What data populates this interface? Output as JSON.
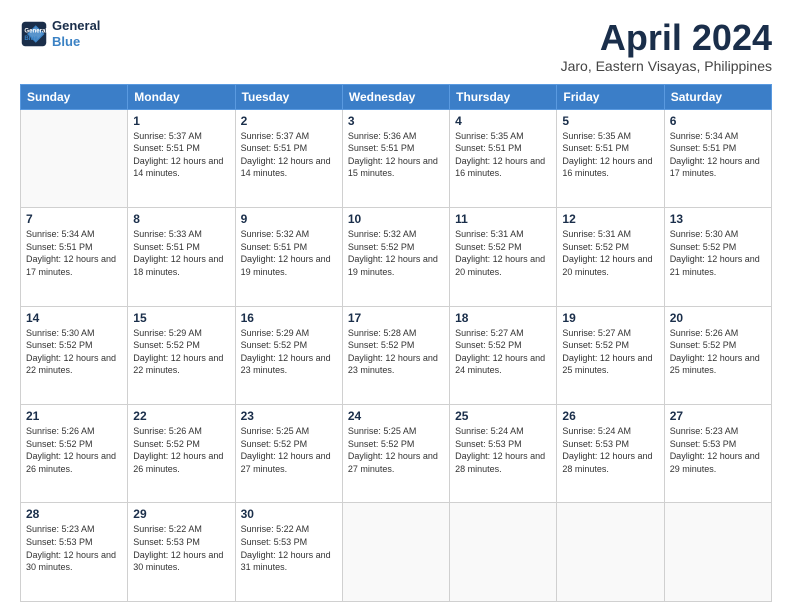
{
  "header": {
    "logo_line1": "General",
    "logo_line2": "Blue",
    "month_title": "April 2024",
    "location": "Jaro, Eastern Visayas, Philippines"
  },
  "columns": [
    "Sunday",
    "Monday",
    "Tuesday",
    "Wednesday",
    "Thursday",
    "Friday",
    "Saturday"
  ],
  "weeks": [
    [
      {
        "day": "",
        "sunrise": "",
        "sunset": "",
        "daylight": ""
      },
      {
        "day": "1",
        "sunrise": "5:37 AM",
        "sunset": "5:51 PM",
        "daylight": "12 hours and 14 minutes."
      },
      {
        "day": "2",
        "sunrise": "5:37 AM",
        "sunset": "5:51 PM",
        "daylight": "12 hours and 14 minutes."
      },
      {
        "day": "3",
        "sunrise": "5:36 AM",
        "sunset": "5:51 PM",
        "daylight": "12 hours and 15 minutes."
      },
      {
        "day": "4",
        "sunrise": "5:35 AM",
        "sunset": "5:51 PM",
        "daylight": "12 hours and 16 minutes."
      },
      {
        "day": "5",
        "sunrise": "5:35 AM",
        "sunset": "5:51 PM",
        "daylight": "12 hours and 16 minutes."
      },
      {
        "day": "6",
        "sunrise": "5:34 AM",
        "sunset": "5:51 PM",
        "daylight": "12 hours and 17 minutes."
      }
    ],
    [
      {
        "day": "7",
        "sunrise": "5:34 AM",
        "sunset": "5:51 PM",
        "daylight": "12 hours and 17 minutes."
      },
      {
        "day": "8",
        "sunrise": "5:33 AM",
        "sunset": "5:51 PM",
        "daylight": "12 hours and 18 minutes."
      },
      {
        "day": "9",
        "sunrise": "5:32 AM",
        "sunset": "5:51 PM",
        "daylight": "12 hours and 19 minutes."
      },
      {
        "day": "10",
        "sunrise": "5:32 AM",
        "sunset": "5:52 PM",
        "daylight": "12 hours and 19 minutes."
      },
      {
        "day": "11",
        "sunrise": "5:31 AM",
        "sunset": "5:52 PM",
        "daylight": "12 hours and 20 minutes."
      },
      {
        "day": "12",
        "sunrise": "5:31 AM",
        "sunset": "5:52 PM",
        "daylight": "12 hours and 20 minutes."
      },
      {
        "day": "13",
        "sunrise": "5:30 AM",
        "sunset": "5:52 PM",
        "daylight": "12 hours and 21 minutes."
      }
    ],
    [
      {
        "day": "14",
        "sunrise": "5:30 AM",
        "sunset": "5:52 PM",
        "daylight": "12 hours and 22 minutes."
      },
      {
        "day": "15",
        "sunrise": "5:29 AM",
        "sunset": "5:52 PM",
        "daylight": "12 hours and 22 minutes."
      },
      {
        "day": "16",
        "sunrise": "5:29 AM",
        "sunset": "5:52 PM",
        "daylight": "12 hours and 23 minutes."
      },
      {
        "day": "17",
        "sunrise": "5:28 AM",
        "sunset": "5:52 PM",
        "daylight": "12 hours and 23 minutes."
      },
      {
        "day": "18",
        "sunrise": "5:27 AM",
        "sunset": "5:52 PM",
        "daylight": "12 hours and 24 minutes."
      },
      {
        "day": "19",
        "sunrise": "5:27 AM",
        "sunset": "5:52 PM",
        "daylight": "12 hours and 25 minutes."
      },
      {
        "day": "20",
        "sunrise": "5:26 AM",
        "sunset": "5:52 PM",
        "daylight": "12 hours and 25 minutes."
      }
    ],
    [
      {
        "day": "21",
        "sunrise": "5:26 AM",
        "sunset": "5:52 PM",
        "daylight": "12 hours and 26 minutes."
      },
      {
        "day": "22",
        "sunrise": "5:26 AM",
        "sunset": "5:52 PM",
        "daylight": "12 hours and 26 minutes."
      },
      {
        "day": "23",
        "sunrise": "5:25 AM",
        "sunset": "5:52 PM",
        "daylight": "12 hours and 27 minutes."
      },
      {
        "day": "24",
        "sunrise": "5:25 AM",
        "sunset": "5:52 PM",
        "daylight": "12 hours and 27 minutes."
      },
      {
        "day": "25",
        "sunrise": "5:24 AM",
        "sunset": "5:53 PM",
        "daylight": "12 hours and 28 minutes."
      },
      {
        "day": "26",
        "sunrise": "5:24 AM",
        "sunset": "5:53 PM",
        "daylight": "12 hours and 28 minutes."
      },
      {
        "day": "27",
        "sunrise": "5:23 AM",
        "sunset": "5:53 PM",
        "daylight": "12 hours and 29 minutes."
      }
    ],
    [
      {
        "day": "28",
        "sunrise": "5:23 AM",
        "sunset": "5:53 PM",
        "daylight": "12 hours and 30 minutes."
      },
      {
        "day": "29",
        "sunrise": "5:22 AM",
        "sunset": "5:53 PM",
        "daylight": "12 hours and 30 minutes."
      },
      {
        "day": "30",
        "sunrise": "5:22 AM",
        "sunset": "5:53 PM",
        "daylight": "12 hours and 31 minutes."
      },
      {
        "day": "",
        "sunrise": "",
        "sunset": "",
        "daylight": ""
      },
      {
        "day": "",
        "sunrise": "",
        "sunset": "",
        "daylight": ""
      },
      {
        "day": "",
        "sunrise": "",
        "sunset": "",
        "daylight": ""
      },
      {
        "day": "",
        "sunrise": "",
        "sunset": "",
        "daylight": ""
      }
    ]
  ]
}
